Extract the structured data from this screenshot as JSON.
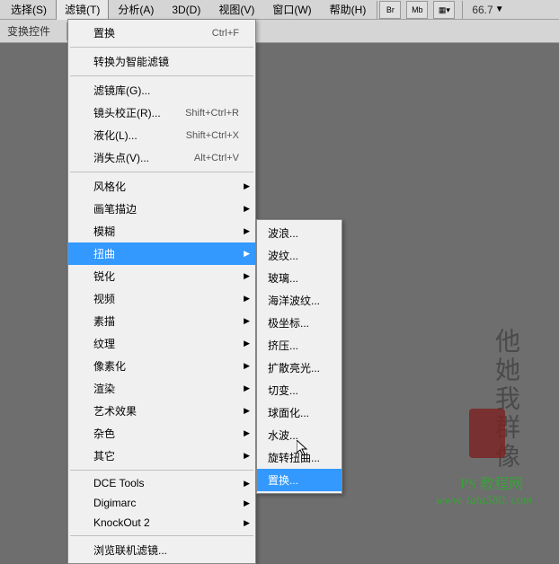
{
  "menubar": {
    "items": [
      "选择(S)",
      "滤镜(T)",
      "分析(A)",
      "3D(D)",
      "视图(V)",
      "窗口(W)",
      "帮助(H)"
    ],
    "active_index": 1
  },
  "toolbar": {
    "buttons": [
      "Br",
      "Mb"
    ],
    "zoom": "66.7",
    "zoom_arrow": "▼"
  },
  "secondary": {
    "label": "变换控件"
  },
  "filter_menu": {
    "groups": [
      [
        {
          "label": "置换",
          "shortcut": "Ctrl+F",
          "arrow": false
        }
      ],
      [
        {
          "label": "转换为智能滤镜",
          "shortcut": "",
          "arrow": false
        }
      ],
      [
        {
          "label": "滤镜库(G)...",
          "shortcut": "",
          "arrow": false
        },
        {
          "label": "镜头校正(R)...",
          "shortcut": "Shift+Ctrl+R",
          "arrow": false
        },
        {
          "label": "液化(L)...",
          "shortcut": "Shift+Ctrl+X",
          "arrow": false
        },
        {
          "label": "消失点(V)...",
          "shortcut": "Alt+Ctrl+V",
          "arrow": false
        }
      ],
      [
        {
          "label": "风格化",
          "shortcut": "",
          "arrow": true
        },
        {
          "label": "画笔描边",
          "shortcut": "",
          "arrow": true
        },
        {
          "label": "模糊",
          "shortcut": "",
          "arrow": true
        },
        {
          "label": "扭曲",
          "shortcut": "",
          "arrow": true,
          "highlighted": true
        },
        {
          "label": "锐化",
          "shortcut": "",
          "arrow": true
        },
        {
          "label": "视频",
          "shortcut": "",
          "arrow": true
        },
        {
          "label": "素描",
          "shortcut": "",
          "arrow": true
        },
        {
          "label": "纹理",
          "shortcut": "",
          "arrow": true
        },
        {
          "label": "像素化",
          "shortcut": "",
          "arrow": true
        },
        {
          "label": "渲染",
          "shortcut": "",
          "arrow": true
        },
        {
          "label": "艺术效果",
          "shortcut": "",
          "arrow": true
        },
        {
          "label": "杂色",
          "shortcut": "",
          "arrow": true
        },
        {
          "label": "其它",
          "shortcut": "",
          "arrow": true
        }
      ],
      [
        {
          "label": "DCE Tools",
          "shortcut": "",
          "arrow": true
        },
        {
          "label": "Digimarc",
          "shortcut": "",
          "arrow": true
        },
        {
          "label": "KnockOut 2",
          "shortcut": "",
          "arrow": true
        }
      ],
      [
        {
          "label": "浏览联机滤镜...",
          "shortcut": "",
          "arrow": false
        }
      ]
    ]
  },
  "distort_submenu": {
    "items": [
      {
        "label": "波浪..."
      },
      {
        "label": "波纹..."
      },
      {
        "label": "玻璃..."
      },
      {
        "label": "海洋波纹..."
      },
      {
        "label": "极坐标..."
      },
      {
        "label": "挤压..."
      },
      {
        "label": "扩散亮光..."
      },
      {
        "label": "切变..."
      },
      {
        "label": "球面化..."
      },
      {
        "label": "水波..."
      },
      {
        "label": "旋转扭曲..."
      },
      {
        "label": "置换...",
        "highlighted": true
      }
    ]
  },
  "watermark": {
    "text1": "他她我群像",
    "text2": "PS 教程网",
    "url": "www. tata580. com"
  }
}
